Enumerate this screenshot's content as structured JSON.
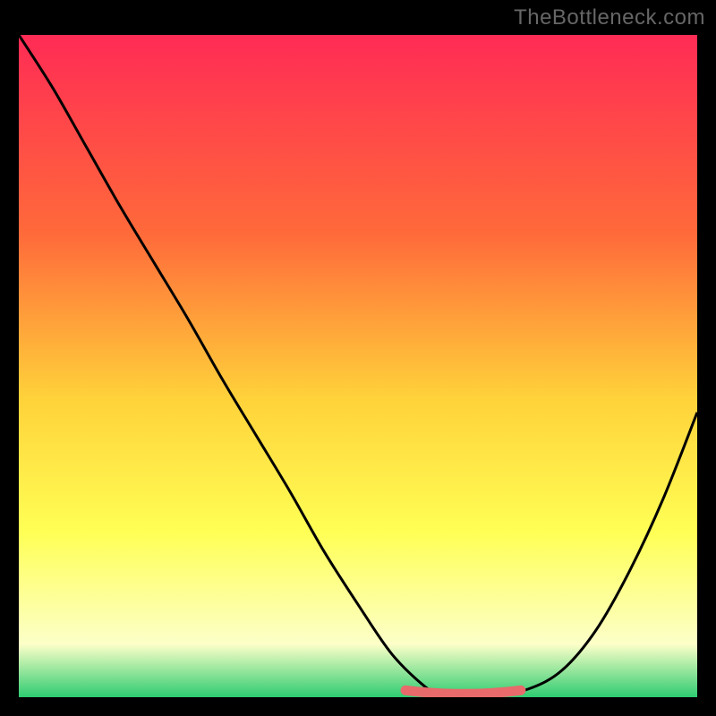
{
  "watermark": "TheBottleneck.com",
  "colors": {
    "bg": "#000000",
    "gradient_top": "#ff2b55",
    "gradient_mid1": "#ff6a3a",
    "gradient_mid2": "#ffd23a",
    "gradient_mid3": "#ffff55",
    "gradient_mid4": "#fcffc8",
    "gradient_bottom": "#2ecc71",
    "curve": "#000000",
    "highlight": "#e86a6a"
  },
  "chart_data": {
    "type": "line",
    "title": "",
    "xlabel": "",
    "ylabel": "",
    "xlim": [
      0,
      100
    ],
    "ylim": [
      0,
      100
    ],
    "x": [
      0,
      5,
      10,
      15,
      20,
      25,
      30,
      35,
      40,
      45,
      50,
      55,
      60,
      62,
      65,
      70,
      75,
      80,
      85,
      90,
      95,
      100
    ],
    "values": [
      100,
      92,
      83,
      74,
      65.5,
      57,
      48,
      39.5,
      31,
      22,
      14,
      6.5,
      1.5,
      0.8,
      0.5,
      0.5,
      1.2,
      4,
      10,
      19,
      30,
      43
    ],
    "highlight_range": {
      "x_start": 57,
      "x_end": 74,
      "y": 0.5
    }
  }
}
